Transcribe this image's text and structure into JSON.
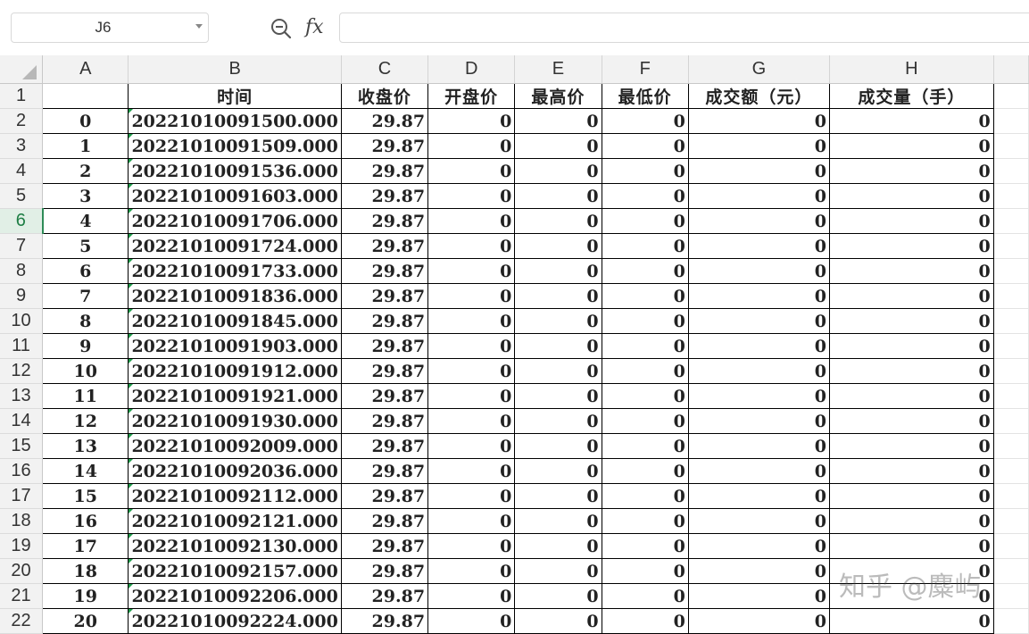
{
  "formula_bar": {
    "name_box": "J6",
    "fx_label": "fx",
    "formula": ""
  },
  "columns": [
    "A",
    "B",
    "C",
    "D",
    "E",
    "F",
    "G",
    "H"
  ],
  "row_numbers": [
    "1",
    "2",
    "3",
    "4",
    "5",
    "6",
    "7",
    "8",
    "9",
    "10",
    "11",
    "12",
    "13",
    "14",
    "15",
    "16",
    "17",
    "18",
    "19",
    "20",
    "21",
    "22"
  ],
  "active_row": "6",
  "headers": [
    "",
    "时间",
    "收盘价",
    "开盘价",
    "最高价",
    "最低价",
    "成交额（元）",
    "成交量（手）"
  ],
  "rows": [
    [
      "0",
      "20221010091500.000",
      "29.87",
      "0",
      "0",
      "0",
      "0",
      "0"
    ],
    [
      "1",
      "20221010091509.000",
      "29.87",
      "0",
      "0",
      "0",
      "0",
      "0"
    ],
    [
      "2",
      "20221010091536.000",
      "29.87",
      "0",
      "0",
      "0",
      "0",
      "0"
    ],
    [
      "3",
      "20221010091603.000",
      "29.87",
      "0",
      "0",
      "0",
      "0",
      "0"
    ],
    [
      "4",
      "20221010091706.000",
      "29.87",
      "0",
      "0",
      "0",
      "0",
      "0"
    ],
    [
      "5",
      "20221010091724.000",
      "29.87",
      "0",
      "0",
      "0",
      "0",
      "0"
    ],
    [
      "6",
      "20221010091733.000",
      "29.87",
      "0",
      "0",
      "0",
      "0",
      "0"
    ],
    [
      "7",
      "20221010091836.000",
      "29.87",
      "0",
      "0",
      "0",
      "0",
      "0"
    ],
    [
      "8",
      "20221010091845.000",
      "29.87",
      "0",
      "0",
      "0",
      "0",
      "0"
    ],
    [
      "9",
      "20221010091903.000",
      "29.87",
      "0",
      "0",
      "0",
      "0",
      "0"
    ],
    [
      "10",
      "20221010091912.000",
      "29.87",
      "0",
      "0",
      "0",
      "0",
      "0"
    ],
    [
      "11",
      "20221010091921.000",
      "29.87",
      "0",
      "0",
      "0",
      "0",
      "0"
    ],
    [
      "12",
      "20221010091930.000",
      "29.87",
      "0",
      "0",
      "0",
      "0",
      "0"
    ],
    [
      "13",
      "20221010092009.000",
      "29.87",
      "0",
      "0",
      "0",
      "0",
      "0"
    ],
    [
      "14",
      "20221010092036.000",
      "29.87",
      "0",
      "0",
      "0",
      "0",
      "0"
    ],
    [
      "15",
      "20221010092112.000",
      "29.87",
      "0",
      "0",
      "0",
      "0",
      "0"
    ],
    [
      "16",
      "20221010092121.000",
      "29.87",
      "0",
      "0",
      "0",
      "0",
      "0"
    ],
    [
      "17",
      "20221010092130.000",
      "29.87",
      "0",
      "0",
      "0",
      "0",
      "0"
    ],
    [
      "18",
      "20221010092157.000",
      "29.87",
      "0",
      "0",
      "0",
      "0",
      "0"
    ],
    [
      "19",
      "20221010092206.000",
      "29.87",
      "0",
      "0",
      "0",
      "0",
      "0"
    ],
    [
      "20",
      "20221010092224.000",
      "29.87",
      "0",
      "0",
      "0",
      "0",
      "0"
    ]
  ],
  "watermark": "知乎 @麋屿",
  "colors": {
    "active_accent": "#2e8b57",
    "header_bg": "#f2f2f2"
  },
  "icons": {
    "zoom": "zoom-magnifier-icon",
    "name_box_dropdown": "chevron-down-icon"
  }
}
